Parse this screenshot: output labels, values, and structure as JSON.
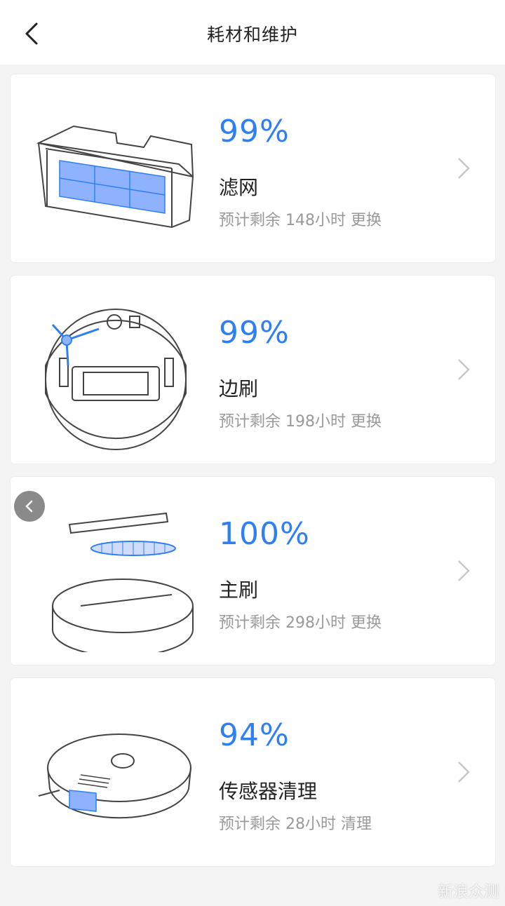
{
  "header": {
    "title": "耗材和维护",
    "back_icon": "chevron-left-icon"
  },
  "items": [
    {
      "percent": "99%",
      "name": "滤网",
      "remaining": "预计剩余 148小时",
      "action": "更换",
      "icon": "filter-image"
    },
    {
      "percent": "99%",
      "name": "边刷",
      "remaining": "预计剩余 198小时",
      "action": "更换",
      "icon": "side-brush-image"
    },
    {
      "percent": "100%",
      "name": "主刷",
      "remaining": "预计剩余 298小时",
      "action": "更换",
      "icon": "main-brush-image"
    },
    {
      "percent": "94%",
      "name": "传感器清理",
      "remaining": "预计剩余 28小时",
      "action": "清理",
      "icon": "sensor-image"
    }
  ],
  "watermark": "新浪众测",
  "colors": {
    "accent": "#2f7ff4",
    "highlight": "#8fb2ff"
  }
}
